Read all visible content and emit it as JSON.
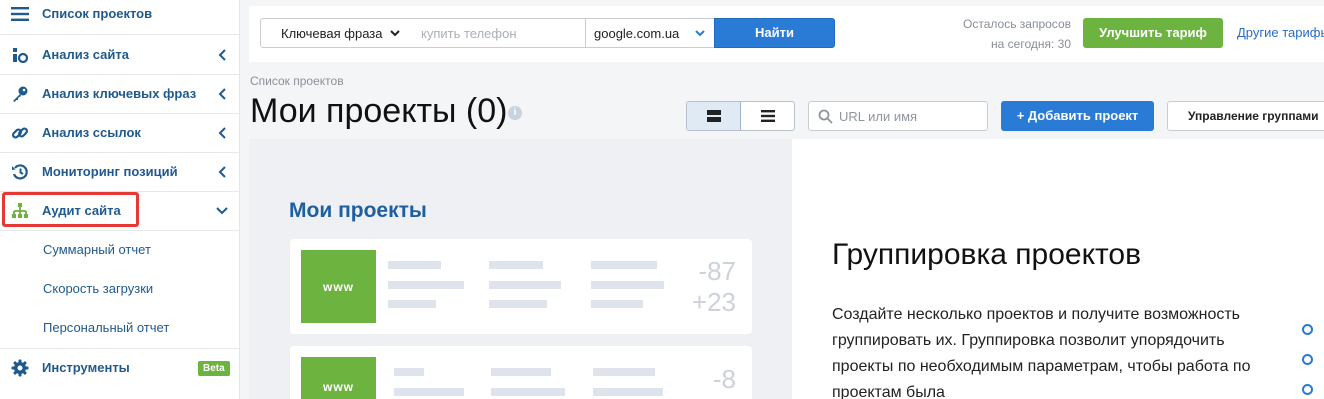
{
  "sidebar": {
    "items": [
      {
        "label": "Список проектов",
        "icon": "menu-icon"
      },
      {
        "label": "Анализ сайта",
        "icon": "site-analysis-icon"
      },
      {
        "label": "Анализ ключевых фраз",
        "icon": "key-icon"
      },
      {
        "label": "Анализ ссылок",
        "icon": "link-icon"
      },
      {
        "label": "Мониторинг позиций",
        "icon": "history-icon"
      },
      {
        "label": "Аудит сайта",
        "icon": "sitemap-icon"
      }
    ],
    "subitems": [
      {
        "label": "Суммарный отчет"
      },
      {
        "label": "Скорость загрузки"
      },
      {
        "label": "Персональный отчет"
      }
    ],
    "tools": {
      "label": "Инструменты",
      "badge": "Beta"
    },
    "highlight_color": "#e53935"
  },
  "search": {
    "mode": "Ключевая фраза",
    "phrase_placeholder": "купить телефон",
    "engine": "google.com.ua",
    "submit": "Найти"
  },
  "limits": {
    "line1": "Осталось запросов",
    "line2": "на сегодня: 30"
  },
  "upgrade_label": "Улучшить тариф",
  "other_plans_label": "Другие тарифы",
  "breadcrumb": "Список проектов",
  "page_title": "Мои проекты (0)",
  "info_icon_glyph": "i",
  "url_search_placeholder": "URL или имя",
  "add_project_label": "+ Добавить проект",
  "manage_groups_label": "Управление группами",
  "preview": {
    "title": "Мои проекты",
    "cards": [
      {
        "badge": "www",
        "numbers": [
          "-87",
          "+23"
        ]
      },
      {
        "badge": "www",
        "numbers": [
          "-8"
        ]
      }
    ]
  },
  "promo": {
    "title": "Группировка проектов",
    "text": "Создайте несколько проектов и получите возможность группировать их. Группировка позволит упорядочить проекты по необходимым параметрам, чтобы работа по проектам была"
  },
  "colors": {
    "primary": "#2a7bd6",
    "green": "#6db33f",
    "link": "#1f5a8f"
  }
}
